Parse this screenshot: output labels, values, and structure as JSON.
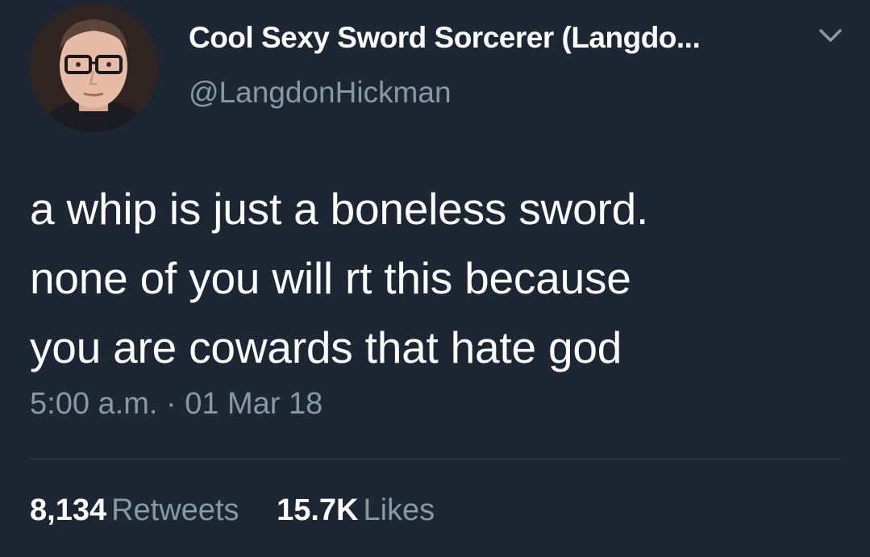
{
  "user": {
    "display_name": "Cool Sexy Sword Sorcerer (Langdo...",
    "handle": "@LangdonHickman",
    "avatar": "profile-photo"
  },
  "tweet": {
    "lines": [
      "a whip is just a boneless sword.",
      "none of you will rt this because",
      "you are cowards that hate god"
    ],
    "timestamp": "5:00 a.m. · 01 Mar 18"
  },
  "stats": {
    "retweets_count": "8,134",
    "retweets_label": "Retweets",
    "likes_count": "15.7K",
    "likes_label": "Likes"
  },
  "icons": {
    "menu": "chevron-down-icon"
  },
  "colors": {
    "background": "#1c2733",
    "primary_text": "#ffffff",
    "secondary_text": "#8899a6",
    "divider": "#38444d"
  }
}
